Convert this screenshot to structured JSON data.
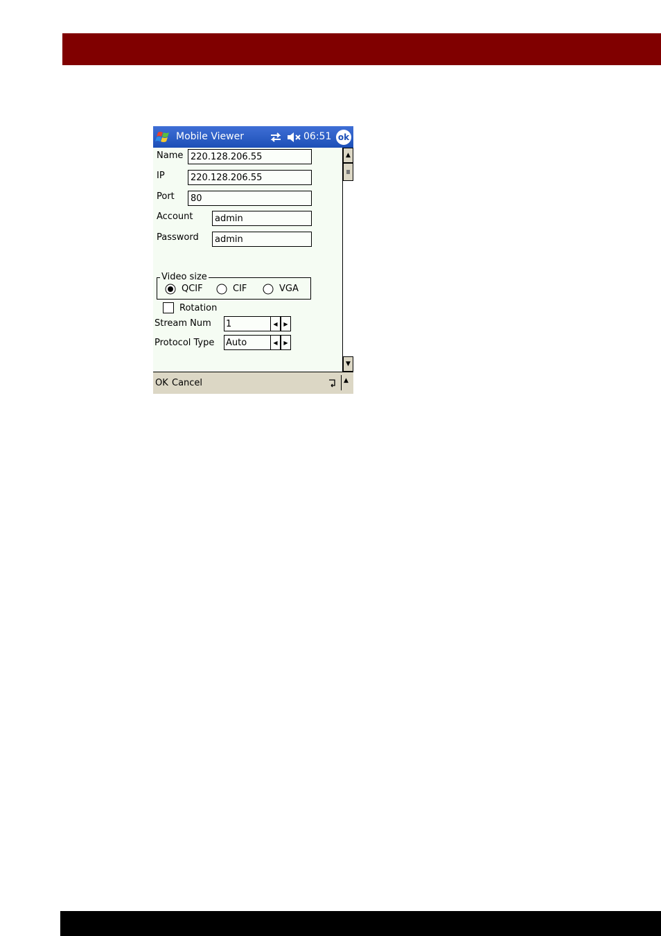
{
  "app": {
    "title": "Mobile Viewer",
    "clock": "06:51",
    "ok_label": "ok"
  },
  "form": {
    "name_label": "Name",
    "name_value": "220.128.206.55",
    "ip_label": "IP",
    "ip_value": "220.128.206.55",
    "port_label": "Port",
    "port_value": "80",
    "account_label": "Account",
    "account_value": "admin",
    "password_label": "Password",
    "password_value": "admin",
    "video_size": {
      "label": "Video size",
      "options": [
        "QCIF",
        "CIF",
        "VGA"
      ],
      "selected": "QCIF"
    },
    "rotation_label": "Rotation",
    "rotation_checked": false,
    "stream_num_label": "Stream Num",
    "stream_num_value": "1",
    "protocol_type_label": "Protocol Type",
    "protocol_type_value": "Auto"
  },
  "softkeys": {
    "ok": "OK",
    "cancel": "Cancel"
  },
  "colors": {
    "top_band": "#800000",
    "bottom_band": "#000000",
    "title_bar": "#1c4fb7",
    "form_bg": "#f5fcf3",
    "softbar_bg": "#dcd7c5"
  },
  "icons": {
    "start": "windows-flag-icon",
    "connectivity": "connectivity-arrows-icon",
    "volume": "speaker-muted-icon",
    "sip": "keyboard-sip-icon"
  }
}
